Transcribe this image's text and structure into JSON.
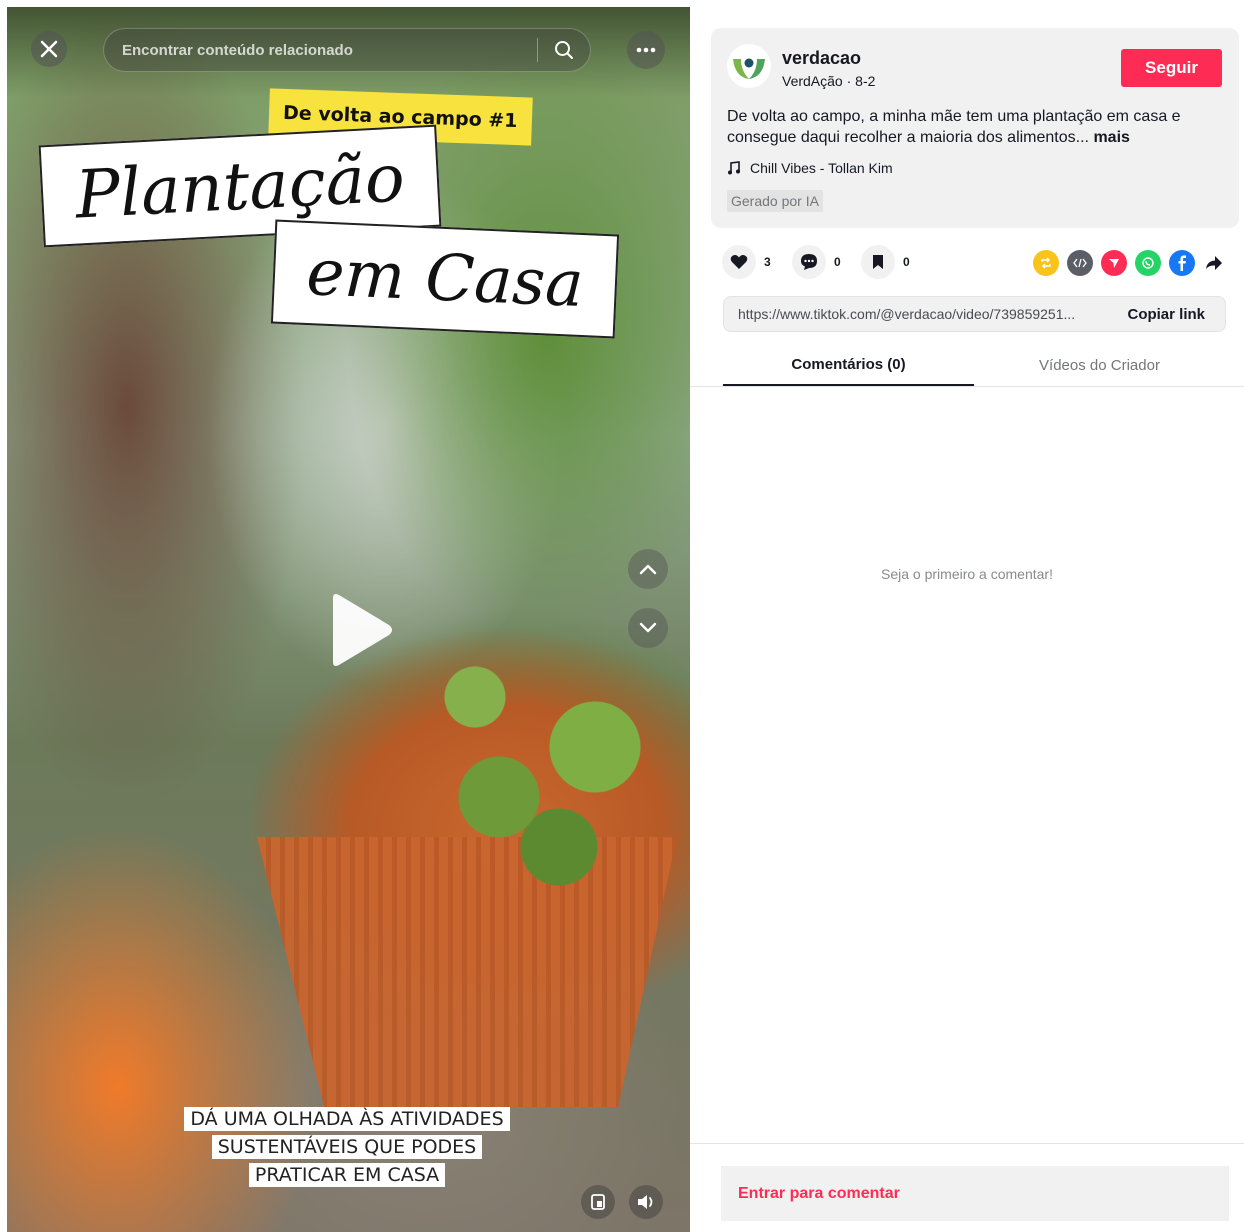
{
  "video": {
    "search_placeholder": "Encontrar conteúdo relacionado",
    "tag_text": "De volta ao campo #1",
    "title_line1": "Plantação",
    "title_line2": "em Casa",
    "caption_line1": "DÁ UMA OLHADA ÀS ATIVIDADES",
    "caption_line2": "SUSTENTÁVEIS QUE PODES",
    "caption_line3": "PRATICAR EM CASA",
    "tag_color": "#f7e23e"
  },
  "creator": {
    "username": "verdacao",
    "subline": "VerdAção · 8-2",
    "follow_label": "Seguir",
    "description": "De volta ao campo, a minha mãe tem uma plantação em casa e consegue daqui recolher a maioria dos alimentos...",
    "more_label": "mais",
    "music": "Chill Vibes - Tollan Kim",
    "ai_badge": "Gerado por IA"
  },
  "actions": {
    "likes": "3",
    "comments": "0",
    "saves": "0",
    "share_icons": [
      "repost-icon",
      "embed-icon",
      "send-icon",
      "whatsapp-icon",
      "facebook-icon",
      "share-arrow-icon"
    ]
  },
  "link": {
    "url": "https://www.tiktok.com/@verdacao/video/739859251...",
    "copy_label": "Copiar link"
  },
  "tabs": {
    "comments": "Comentários (0)",
    "creator_videos": "Vídeos do Criador"
  },
  "comments": {
    "empty_text": "Seja o primeiro a comentar!",
    "login_prompt": "Entrar para comentar"
  },
  "colors": {
    "accent": "#fe2c55",
    "panel_bg": "#f1f1f2"
  }
}
